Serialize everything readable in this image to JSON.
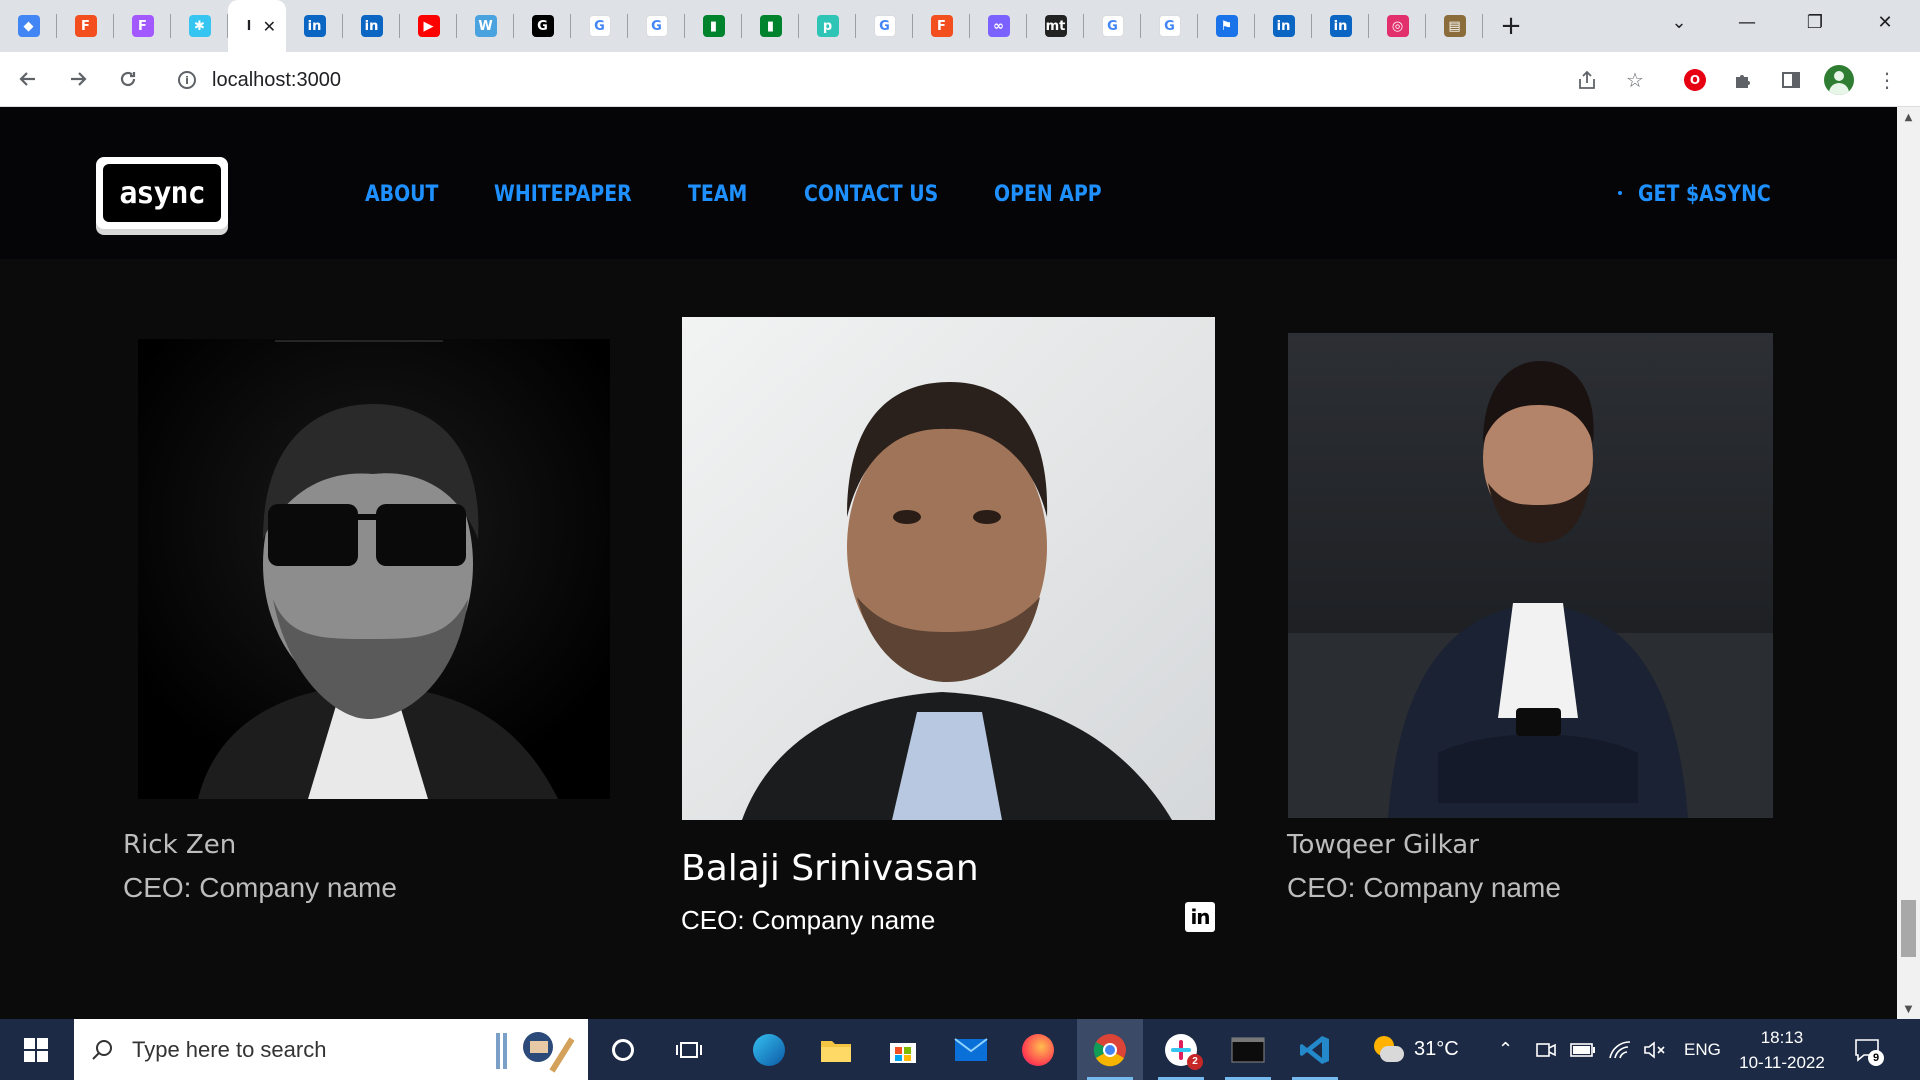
{
  "browser": {
    "tabs": [
      {
        "icon": "diamond-app-icon",
        "color": "#4285f4"
      },
      {
        "icon": "figma-icon",
        "color": "#f24e1e"
      },
      {
        "icon": "figma-icon",
        "color": "#a259ff"
      },
      {
        "icon": "slack-icon",
        "color": "#36c5f0"
      },
      {
        "icon": "page-icon",
        "color": "#5f6368",
        "active": true,
        "title": "l"
      },
      {
        "icon": "linkedin-icon",
        "color": "#0a66c2"
      },
      {
        "icon": "linkedin-icon",
        "color": "#0a66c2"
      },
      {
        "icon": "youtube-icon",
        "color": "#ff0000"
      },
      {
        "icon": "web-icon",
        "color": "#4aa3df"
      },
      {
        "icon": "github-icon",
        "color": "#000000"
      },
      {
        "icon": "google-icon",
        "color": "#4285f4"
      },
      {
        "icon": "google-icon",
        "color": "#4285f4"
      },
      {
        "icon": "google-meet-icon",
        "color": "#00832d"
      },
      {
        "icon": "google-meet-icon",
        "color": "#00832d"
      },
      {
        "icon": "pushbullet-icon",
        "color": "#2ec4b6"
      },
      {
        "icon": "google-icon",
        "color": "#4285f4"
      },
      {
        "icon": "figma-icon",
        "color": "#f24e1e"
      },
      {
        "icon": "web3-icon",
        "color": "#7b61ff"
      },
      {
        "icon": "mt-icon",
        "color": "#222222"
      },
      {
        "icon": "google-icon",
        "color": "#4285f4"
      },
      {
        "icon": "google-icon",
        "color": "#4285f4"
      },
      {
        "icon": "flag-icon",
        "color": "#1a73e8"
      },
      {
        "icon": "linkedin-icon",
        "color": "#0a66c2"
      },
      {
        "icon": "linkedin-icon",
        "color": "#0a66c2"
      },
      {
        "icon": "instagram-icon",
        "color": "#e1306c"
      },
      {
        "icon": "book-icon",
        "color": "#8a6d3b"
      }
    ],
    "active_tab_close": "✕",
    "new_tab": "+",
    "url": "localhost:3000"
  },
  "site": {
    "logo_text": "async",
    "nav": [
      "ABOUT",
      "WHITEPAPER",
      "TEAM",
      "CONTACT US",
      "OPEN APP"
    ],
    "cta": "GET $ASYNC",
    "accent_color": "#1e90ff",
    "team": [
      {
        "name": "Rick Zen",
        "role": "CEO: Company name"
      },
      {
        "name": "Balaji Srinivasan",
        "role": "CEO: Company name",
        "linkedin": "in"
      },
      {
        "name": "Towqeer Gilkar",
        "role": "CEO: Company name"
      }
    ]
  },
  "taskbar": {
    "search_placeholder": "Type here to search",
    "weather": "31°C",
    "language": "ENG",
    "time": "18:13",
    "date": "10-11-2022",
    "notification_count": "9",
    "slack_badge": "2"
  }
}
